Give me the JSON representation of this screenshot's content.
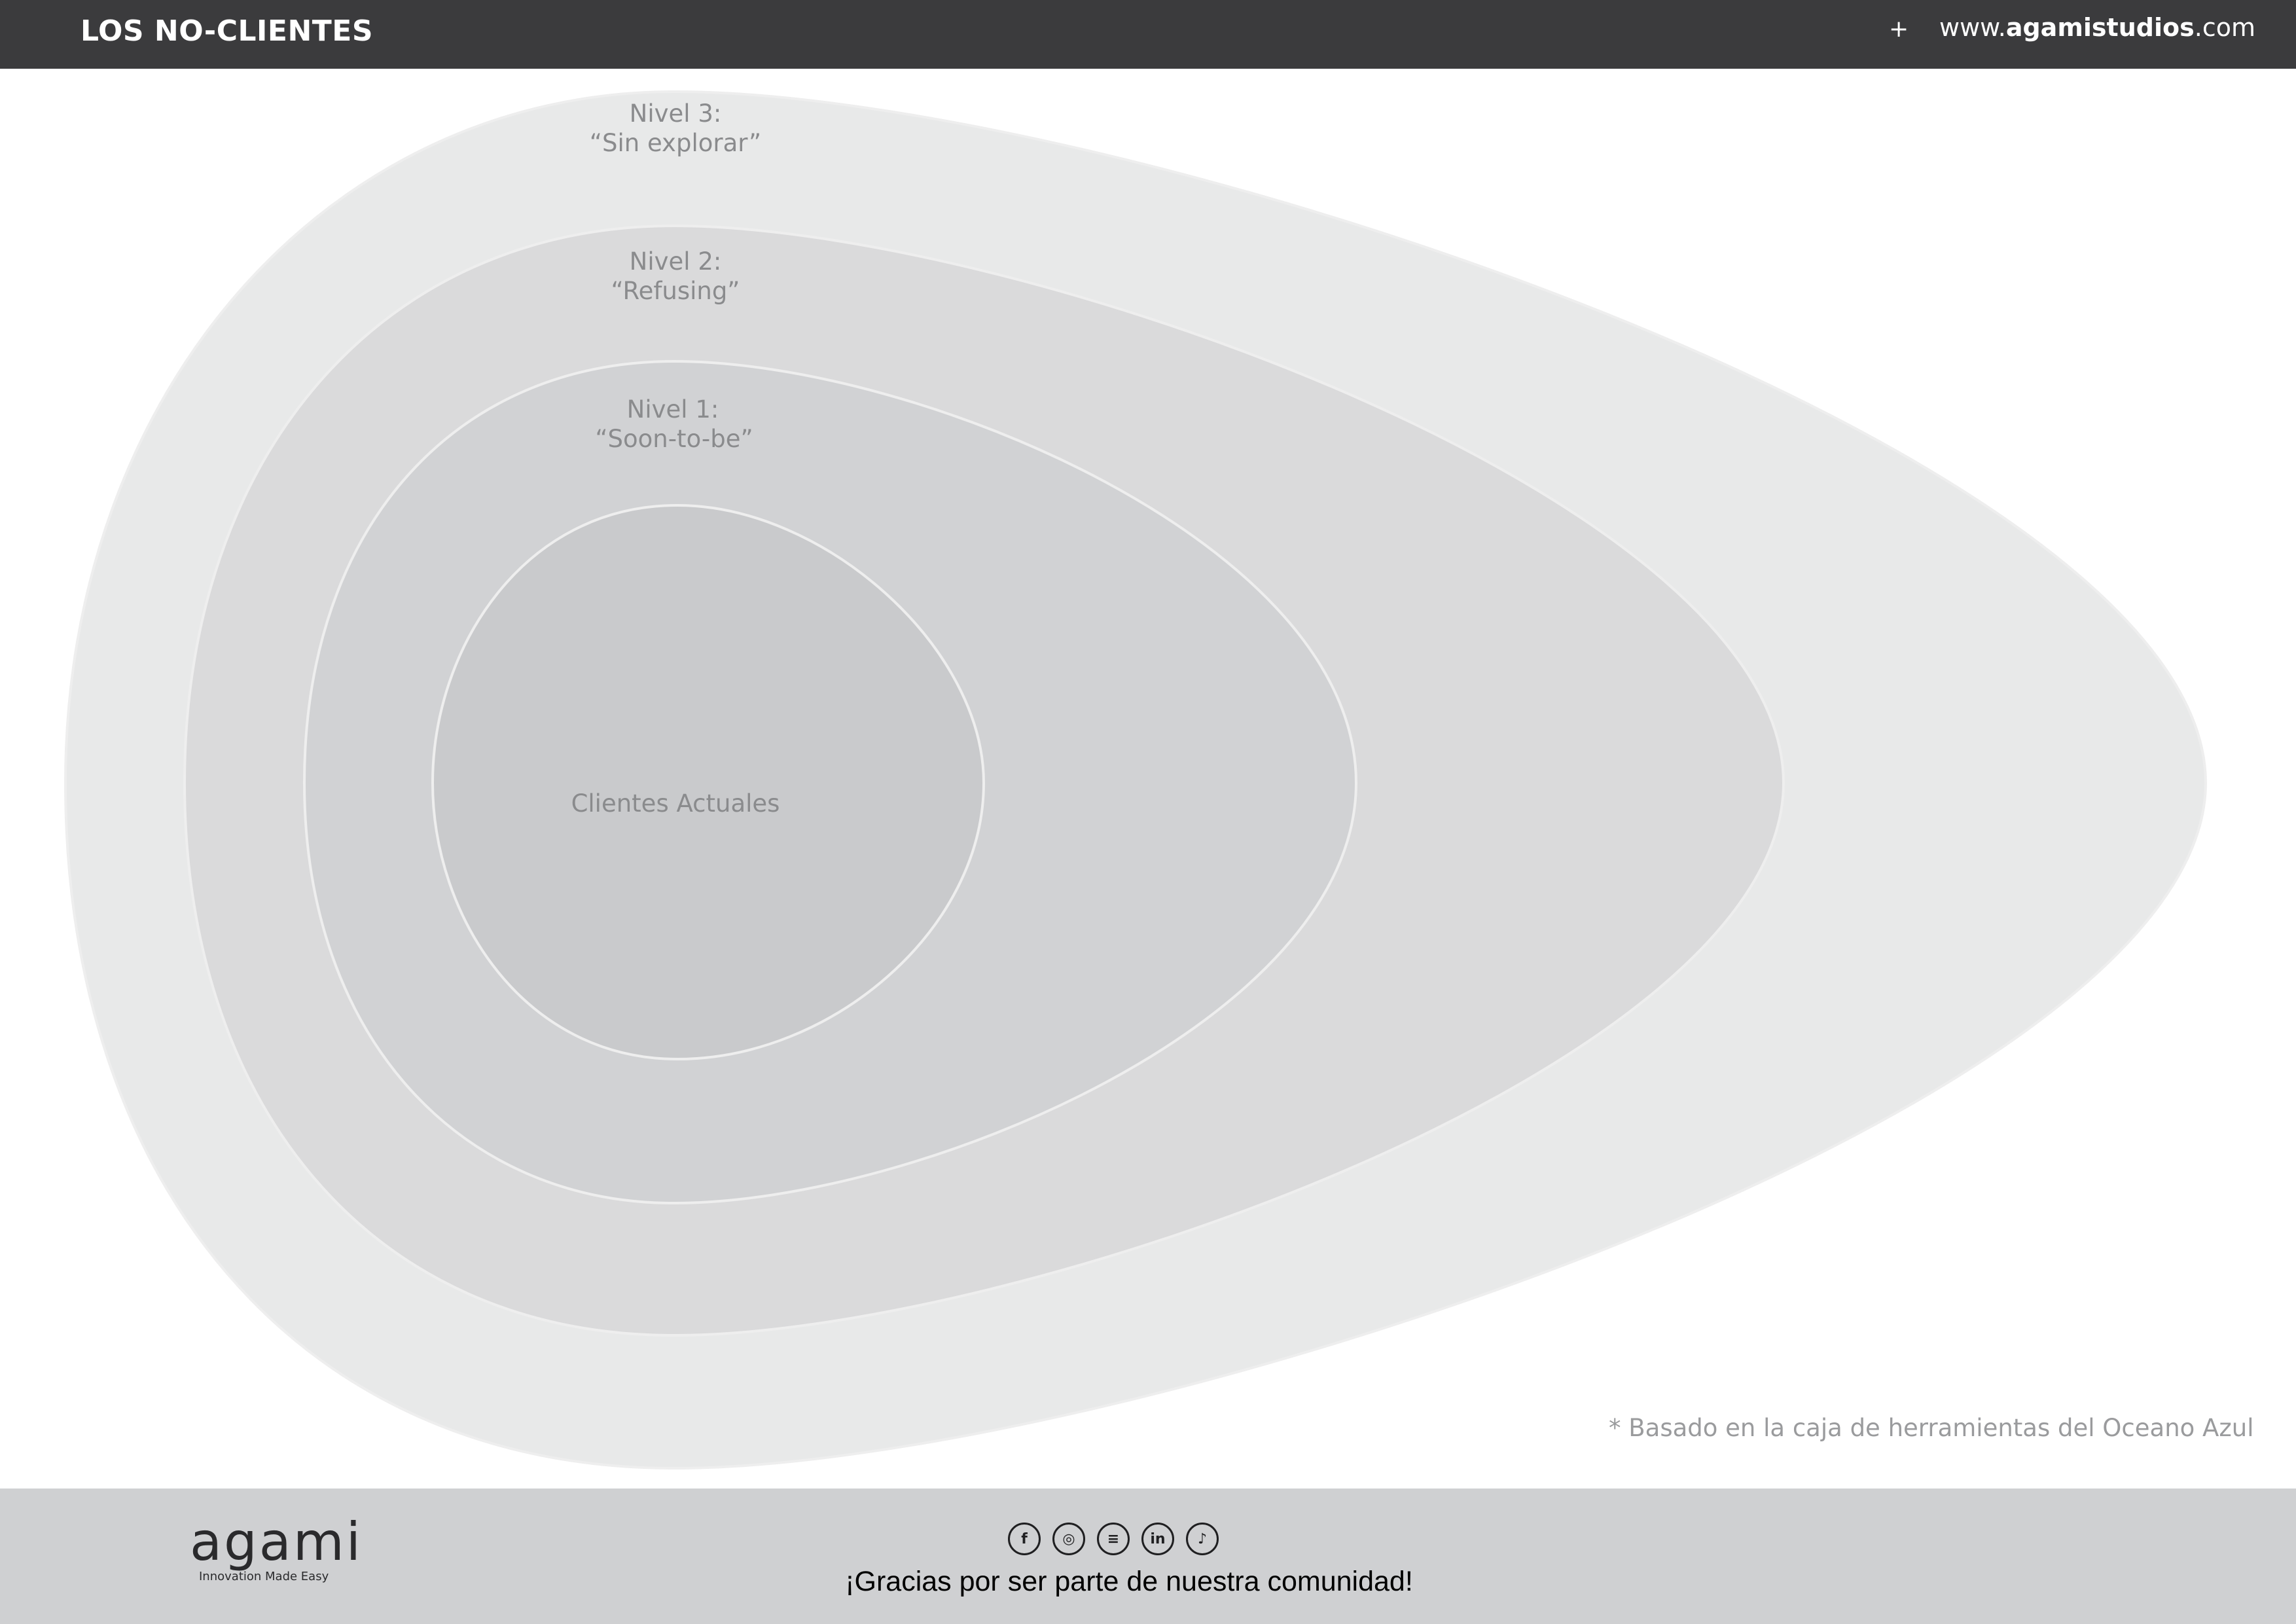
{
  "header": {
    "title": "LOS NO-CLIENTES",
    "plus": "+",
    "url_prefix": "www.",
    "url_brand": "agamistudios",
    "url_suffix": ".com"
  },
  "diagram": {
    "levels": [
      {
        "name": "level-3",
        "line1": "Nivel 3:",
        "line2": "“Sin explorar”",
        "fill": "#e8e9e9"
      },
      {
        "name": "level-2",
        "line1": "Nivel 2:",
        "line2": "“Refusing”",
        "fill": "#dadadb"
      },
      {
        "name": "level-1",
        "line1": "Nivel 1:",
        "line2": "“Soon-to-be”",
        "fill": "#d1d2d4"
      },
      {
        "name": "core",
        "line1": "Clientes Actuales",
        "line2": "",
        "fill": "#c9cacc"
      }
    ],
    "footnote": "* Basado en la caja de herramientas del Oceano Azul"
  },
  "footer": {
    "logo": "agami",
    "tagline": "Innovation Made Easy",
    "social_icons": [
      "facebook-icon",
      "instagram-icon",
      "spotify-icon",
      "linkedin-icon",
      "tiktok-icon"
    ],
    "social_glyphs": [
      "f",
      "◎",
      "≡",
      "in",
      "♪"
    ],
    "thanks": "¡Gracias por ser parte de nuestra comunidad!"
  }
}
